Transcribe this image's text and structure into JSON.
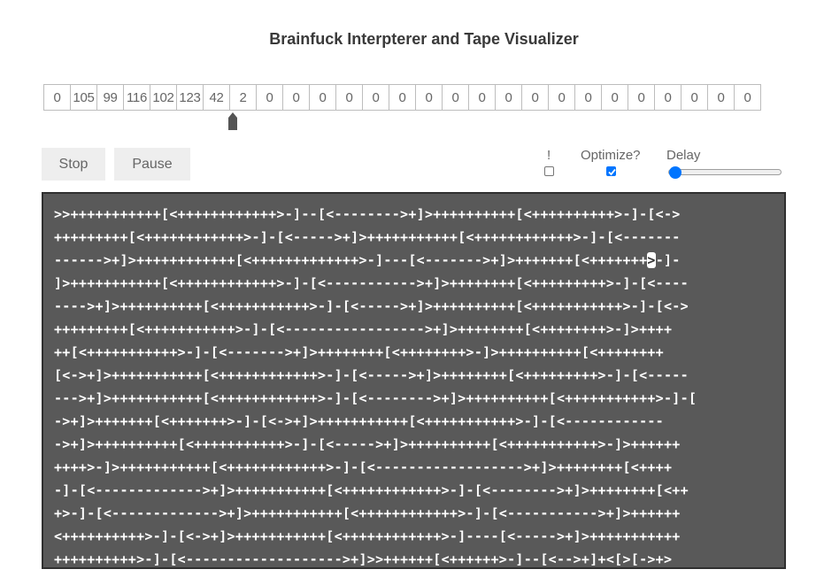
{
  "app": {
    "title": "Brainfuck Interpterer and Tape Visualizer"
  },
  "tape": {
    "cells": [
      "0",
      "105",
      "99",
      "116",
      "102",
      "123",
      "42",
      "2",
      "0",
      "0",
      "0",
      "0",
      "0",
      "0",
      "0",
      "0",
      "0",
      "0",
      "0",
      "0",
      "0",
      "0",
      "0",
      "0",
      "0",
      "0",
      "0"
    ],
    "pointer_index": 6
  },
  "controls": {
    "stop_label": "Stop",
    "pause_label": "Pause",
    "bang_label": "!",
    "bang_checked": false,
    "optimize_label": "Optimize?",
    "optimize_checked": true,
    "delay_label": "Delay",
    "delay_value": 0
  },
  "code": {
    "lines": [
      ">>+++++++++++[<++++++++++++>-]--[<-------->+]>++++++++++[<++++++++++>-]-[<->",
      "+++++++++[<++++++++++++>-]-[<----->+]>+++++++++++[<++++++++++++>-]-[<-------",
      "------>+]>++++++++++++[<+++++++++++++>-]---[<------->+]>+++++++[<+++++++",
      "]>+++++++++++[<++++++++++++>-]-[<----------->+]>++++++++[<+++++++++>-]-[<----",
      "---->+]>++++++++++[<+++++++++++>-]-[<----->+]>++++++++++[<+++++++++++>-]-[<->",
      "+++++++++[<+++++++++++>-]-[<----------------->+]>++++++++[<++++++++>-]>++++",
      "++[<+++++++++++>-]-[<------->+]>++++++++[<++++++++>-]>++++++++++[<++++++++",
      "[<->+]>+++++++++++[<++++++++++++>-]-[<----->+]>++++++++[<+++++++++>-]-[<-----",
      "--->+]>+++++++++++[<++++++++++++>-]-[<-------->+]>++++++++++[<+++++++++++>-]-[",
      "->+]>+++++++[<+++++++>-]-[<->+]>+++++++++++[<+++++++++++>-]-[<------------",
      "->+]>++++++++++[<+++++++++++>-]-[<----->+]>++++++++++[<+++++++++++>-]>++++++",
      "++++>-]>+++++++++++[<++++++++++++>-]-[<------------------>+]>++++++++[<++++",
      "-]-[<------------->+]>+++++++++++[<++++++++++++>-]-[<-------->+]>++++++++[<++",
      "+>-]-[<------------->+]>+++++++++++[<++++++++++++>-]-[<----------->+]>++++++",
      "<++++++++++>-]-[<->+]>+++++++++++[<++++++++++++>-]----[<----->+]>+++++++++++",
      "++++++++++>-]-[<------------------->+]>>++++++[<++++++>-]--[<-->+]+<[>[->+>"
    ],
    "cursor_line": 2,
    "cursor_text_before": "------>+]>++++++++++++[<+++++++++++++>-]---[<------->+]>+++++++[<+++++++",
    "cursor_char": ">",
    "cursor_text_after": "-]-"
  }
}
